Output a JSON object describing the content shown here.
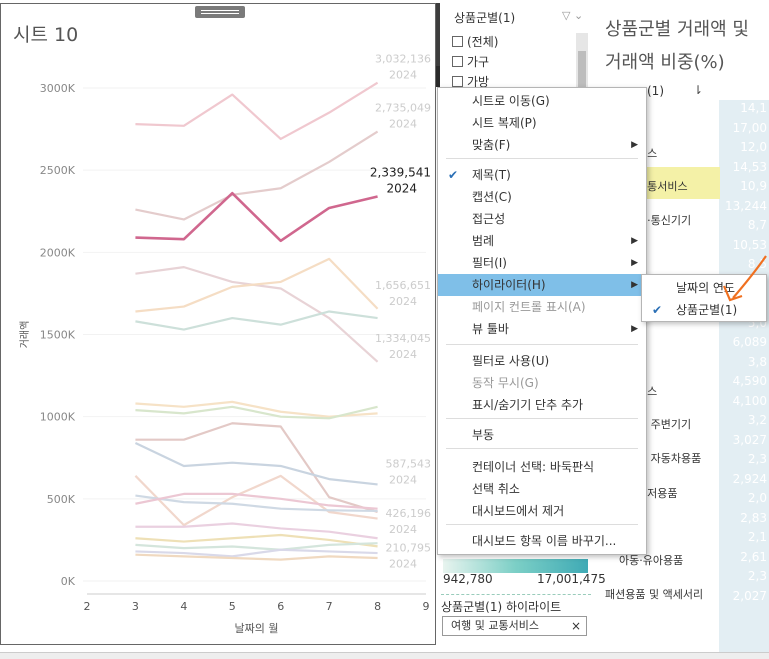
{
  "sheet": {
    "title": "시트 10"
  },
  "chart_data": {
    "type": "line",
    "xlabel": "날짜의 월",
    "ylabel": "거래액",
    "xlim": [
      2,
      9
    ],
    "ylim": [
      0,
      3000000
    ],
    "x_ticks": [
      "2",
      "3",
      "4",
      "5",
      "6",
      "7",
      "8",
      "9"
    ],
    "y_ticks": [
      {
        "v": 0,
        "label": "0K"
      },
      {
        "v": 500000,
        "label": "500K"
      },
      {
        "v": 1000000,
        "label": "1000K"
      },
      {
        "v": 1500000,
        "label": "1500K"
      },
      {
        "v": 2000000,
        "label": "2000K"
      },
      {
        "v": 2500000,
        "label": "2500K"
      },
      {
        "v": 3000000,
        "label": "3000K"
      }
    ],
    "x": [
      3,
      4,
      5,
      6,
      7,
      8
    ],
    "series": [
      {
        "values": [
          2780000,
          2770000,
          2960000,
          2690000,
          2850000,
          3032136
        ],
        "color": "#f0c8cf",
        "highlight": false
      },
      {
        "values": [
          2260000,
          2200000,
          2350000,
          2390000,
          2550000,
          2735049
        ],
        "color": "#e4cccc",
        "highlight": false
      },
      {
        "values": [
          2090000,
          2080000,
          2360000,
          2070000,
          2270000,
          2339541
        ],
        "color": "#d0678e",
        "highlight": true
      },
      {
        "values": [
          1870000,
          1910000,
          1820000,
          1780000,
          1600000,
          1334045
        ],
        "color": "#e8d3d6",
        "highlight": false
      },
      {
        "values": [
          1640000,
          1670000,
          1790000,
          1820000,
          1960000,
          1656651
        ],
        "color": "#f5ddc4",
        "highlight": false
      },
      {
        "values": [
          1580000,
          1530000,
          1600000,
          1560000,
          1640000,
          1600000
        ],
        "color": "#cde0da",
        "highlight": false
      },
      {
        "values": [
          1080000,
          1060000,
          1090000,
          1030000,
          1000000,
          1020000
        ],
        "color": "#f6e2c6",
        "highlight": false
      },
      {
        "values": [
          1040000,
          1020000,
          1060000,
          1000000,
          990000,
          1060000
        ],
        "color": "#d8e6cc",
        "highlight": false
      },
      {
        "values": [
          860000,
          860000,
          960000,
          940000,
          510000,
          420000
        ],
        "color": "#e3c9c6",
        "highlight": false
      },
      {
        "values": [
          840000,
          700000,
          720000,
          700000,
          620000,
          587543
        ],
        "color": "#c9d4e0",
        "highlight": false
      },
      {
        "values": [
          640000,
          340000,
          510000,
          640000,
          420000,
          380000
        ],
        "color": "#f1d7cc",
        "highlight": false
      },
      {
        "values": [
          520000,
          480000,
          470000,
          440000,
          430000,
          426196
        ],
        "color": "#cfd9e4",
        "highlight": false
      },
      {
        "values": [
          470000,
          530000,
          530000,
          500000,
          460000,
          440000
        ],
        "color": "#ecc7d3",
        "highlight": false
      },
      {
        "values": [
          330000,
          330000,
          350000,
          320000,
          300000,
          260000
        ],
        "color": "#ead0e0",
        "highlight": false
      },
      {
        "values": [
          260000,
          240000,
          260000,
          280000,
          250000,
          210795
        ],
        "color": "#eee0b6",
        "highlight": false
      },
      {
        "values": [
          220000,
          200000,
          210000,
          190000,
          220000,
          230000
        ],
        "color": "#d4e5dc",
        "highlight": false
      },
      {
        "values": [
          180000,
          170000,
          150000,
          190000,
          180000,
          170000
        ],
        "color": "#d9d9e9",
        "highlight": false
      },
      {
        "values": [
          160000,
          150000,
          140000,
          130000,
          150000,
          140000
        ],
        "color": "#f0d9c0",
        "highlight": false
      }
    ],
    "end_labels": [
      {
        "value": "3,032,136",
        "year": "2024",
        "y": 3032136,
        "highlight": false
      },
      {
        "value": "2,735,049",
        "year": "2024",
        "y": 2735049,
        "highlight": false
      },
      {
        "value": "2,339,541",
        "year": "2024",
        "y": 2339541,
        "highlight": true
      },
      {
        "value": "1,656,651",
        "year": "2024",
        "y": 1656651,
        "highlight": false
      },
      {
        "value": "1,334,045",
        "year": "2024",
        "y": 1334045,
        "highlight": false
      },
      {
        "value": "587,543",
        "year": "2024",
        "y": 587543,
        "highlight": false
      },
      {
        "value": "426,196",
        "year": "2024",
        "y": 426196,
        "highlight": false
      },
      {
        "value": "210,795",
        "year": "2024",
        "y": 210795,
        "highlight": false
      }
    ]
  },
  "filter": {
    "title": "상품군별(1)",
    "items": [
      "(전체)",
      "가구",
      "가방"
    ]
  },
  "menu": {
    "items": [
      {
        "label": "시트로 이동(G)"
      },
      {
        "label": "시트 복제(P)"
      },
      {
        "label": "맞춤(F)",
        "arrow": true
      },
      {
        "label": "제목(T)",
        "check": true
      },
      {
        "label": "캡션(C)"
      },
      {
        "label": "접근성"
      },
      {
        "label": "범례",
        "arrow": true
      },
      {
        "label": "필터(I)",
        "arrow": true
      },
      {
        "label": "하이라이터(H)",
        "arrow": true,
        "active": true
      },
      {
        "label": "페이지 컨트롤 표시(A)",
        "disabled": true
      },
      {
        "label": "뷰 툴바",
        "arrow": true
      },
      {
        "label": "필터로 사용(U)"
      },
      {
        "label": "동작 무시(G)",
        "disabled": true
      },
      {
        "label": "표시/숨기기 단추 추가"
      },
      {
        "label": "부동"
      },
      {
        "label": "컨테이너 선택: 바둑판식"
      },
      {
        "label": "선택 취소"
      },
      {
        "label": "대시보드에서 제거"
      },
      {
        "label": "대시보드 항목 이름 바꾸기..."
      }
    ],
    "submenu": [
      {
        "label": "날짜의 연도",
        "check": false
      },
      {
        "label": "상품군별(1)",
        "check": true
      }
    ]
  },
  "right_panel": {
    "title_line1": "상품군별 거래액 및",
    "title_line2": "거래액 비중(%)",
    "column_header": "(1)",
    "values": [
      "14,1",
      "17,00",
      "12,0",
      "14,53",
      "10,9",
      "13,244",
      "8,7",
      "10,53",
      "8,5",
      "10,3",
      "6,2",
      "5,0",
      "6,089",
      "3,8",
      "4,590",
      "4,100",
      "3,2",
      "3,027",
      "2,3",
      "2,924",
      "2,0",
      "2,83",
      "2,1",
      "2,61",
      "2,3",
      "2,027"
    ],
    "categories": [
      "품",
      "비스",
      "교통서비스",
      "자·통신기기",
      "품",
      "비스",
      "및 주변기기",
      "및 자동차용품",
      "레저용품",
      "아동·유아용품",
      "패션용품 및 액세서리"
    ]
  },
  "highlighter": {
    "min_label": "942,780",
    "max_label": "17,001,475",
    "title": "상품군별(1) 하이라이트",
    "value": "여행 및 교통서비스",
    "clear": "×"
  }
}
